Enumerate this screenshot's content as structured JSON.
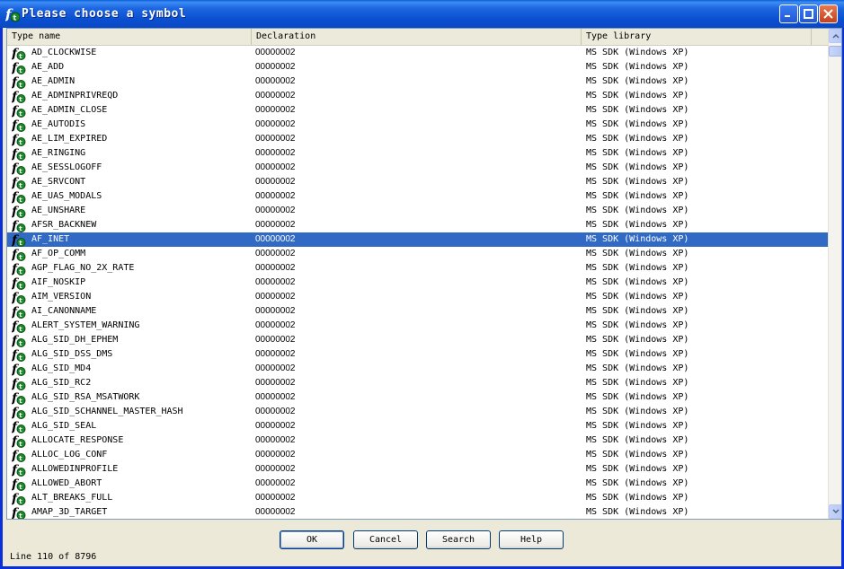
{
  "window": {
    "title": "Please choose a symbol"
  },
  "columns": [
    "Type name",
    "Declaration",
    "Type library"
  ],
  "rows": [
    {
      "name": "AD_CLOCKWISE",
      "decl": "00000002",
      "lib": "MS SDK (Windows XP)"
    },
    {
      "name": "AE_ADD",
      "decl": "00000002",
      "lib": "MS SDK (Windows XP)"
    },
    {
      "name": "AE_ADMIN",
      "decl": "00000002",
      "lib": "MS SDK (Windows XP)"
    },
    {
      "name": "AE_ADMINPRIVREQD",
      "decl": "00000002",
      "lib": "MS SDK (Windows XP)"
    },
    {
      "name": "AE_ADMIN_CLOSE",
      "decl": "00000002",
      "lib": "MS SDK (Windows XP)"
    },
    {
      "name": "AE_AUTODIS",
      "decl": "00000002",
      "lib": "MS SDK (Windows XP)"
    },
    {
      "name": "AE_LIM_EXPIRED",
      "decl": "00000002",
      "lib": "MS SDK (Windows XP)"
    },
    {
      "name": "AE_RINGING",
      "decl": "00000002",
      "lib": "MS SDK (Windows XP)"
    },
    {
      "name": "AE_SESSLOGOFF",
      "decl": "00000002",
      "lib": "MS SDK (Windows XP)"
    },
    {
      "name": "AE_SRVCONT",
      "decl": "00000002",
      "lib": "MS SDK (Windows XP)"
    },
    {
      "name": "AE_UAS_MODALS",
      "decl": "00000002",
      "lib": "MS SDK (Windows XP)"
    },
    {
      "name": "AE_UNSHARE",
      "decl": "00000002",
      "lib": "MS SDK (Windows XP)"
    },
    {
      "name": "AFSR_BACKNEW",
      "decl": "00000002",
      "lib": "MS SDK (Windows XP)"
    },
    {
      "name": "AF_INET",
      "decl": "00000002",
      "lib": "MS SDK (Windows XP)",
      "selected": true
    },
    {
      "name": "AF_OP_COMM",
      "decl": "00000002",
      "lib": "MS SDK (Windows XP)"
    },
    {
      "name": "AGP_FLAG_NO_2X_RATE",
      "decl": "00000002",
      "lib": "MS SDK (Windows XP)"
    },
    {
      "name": "AIF_NOSKIP",
      "decl": "00000002",
      "lib": "MS SDK (Windows XP)"
    },
    {
      "name": "AIM_VERSION",
      "decl": "00000002",
      "lib": "MS SDK (Windows XP)"
    },
    {
      "name": "AI_CANONNAME",
      "decl": "00000002",
      "lib": "MS SDK (Windows XP)"
    },
    {
      "name": "ALERT_SYSTEM_WARNING",
      "decl": "00000002",
      "lib": "MS SDK (Windows XP)"
    },
    {
      "name": "ALG_SID_DH_EPHEM",
      "decl": "00000002",
      "lib": "MS SDK (Windows XP)"
    },
    {
      "name": "ALG_SID_DSS_DMS",
      "decl": "00000002",
      "lib": "MS SDK (Windows XP)"
    },
    {
      "name": "ALG_SID_MD4",
      "decl": "00000002",
      "lib": "MS SDK (Windows XP)"
    },
    {
      "name": "ALG_SID_RC2",
      "decl": "00000002",
      "lib": "MS SDK (Windows XP)"
    },
    {
      "name": "ALG_SID_RSA_MSATWORK",
      "decl": "00000002",
      "lib": "MS SDK (Windows XP)"
    },
    {
      "name": "ALG_SID_SCHANNEL_MASTER_HASH",
      "decl": "00000002",
      "lib": "MS SDK (Windows XP)"
    },
    {
      "name": "ALG_SID_SEAL",
      "decl": "00000002",
      "lib": "MS SDK (Windows XP)"
    },
    {
      "name": "ALLOCATE_RESPONSE",
      "decl": "00000002",
      "lib": "MS SDK (Windows XP)"
    },
    {
      "name": "ALLOC_LOG_CONF",
      "decl": "00000002",
      "lib": "MS SDK (Windows XP)"
    },
    {
      "name": "ALLOWEDINPROFILE",
      "decl": "00000002",
      "lib": "MS SDK (Windows XP)"
    },
    {
      "name": "ALLOWED_ABORT",
      "decl": "00000002",
      "lib": "MS SDK (Windows XP)"
    },
    {
      "name": "ALT_BREAKS_FULL",
      "decl": "00000002",
      "lib": "MS SDK (Windows XP)"
    },
    {
      "name": "AMAP_3D_TARGET",
      "decl": "00000002",
      "lib": "MS SDK (Windows XP)"
    }
  ],
  "buttons": {
    "ok": "OK",
    "cancel": "Cancel",
    "search": "Search",
    "help": "Help"
  },
  "status": "Line 110 of 8796",
  "colors": {
    "titlebar": "#0a5fd8",
    "selection": "#316ac5",
    "dialog": "#ece9d8"
  }
}
